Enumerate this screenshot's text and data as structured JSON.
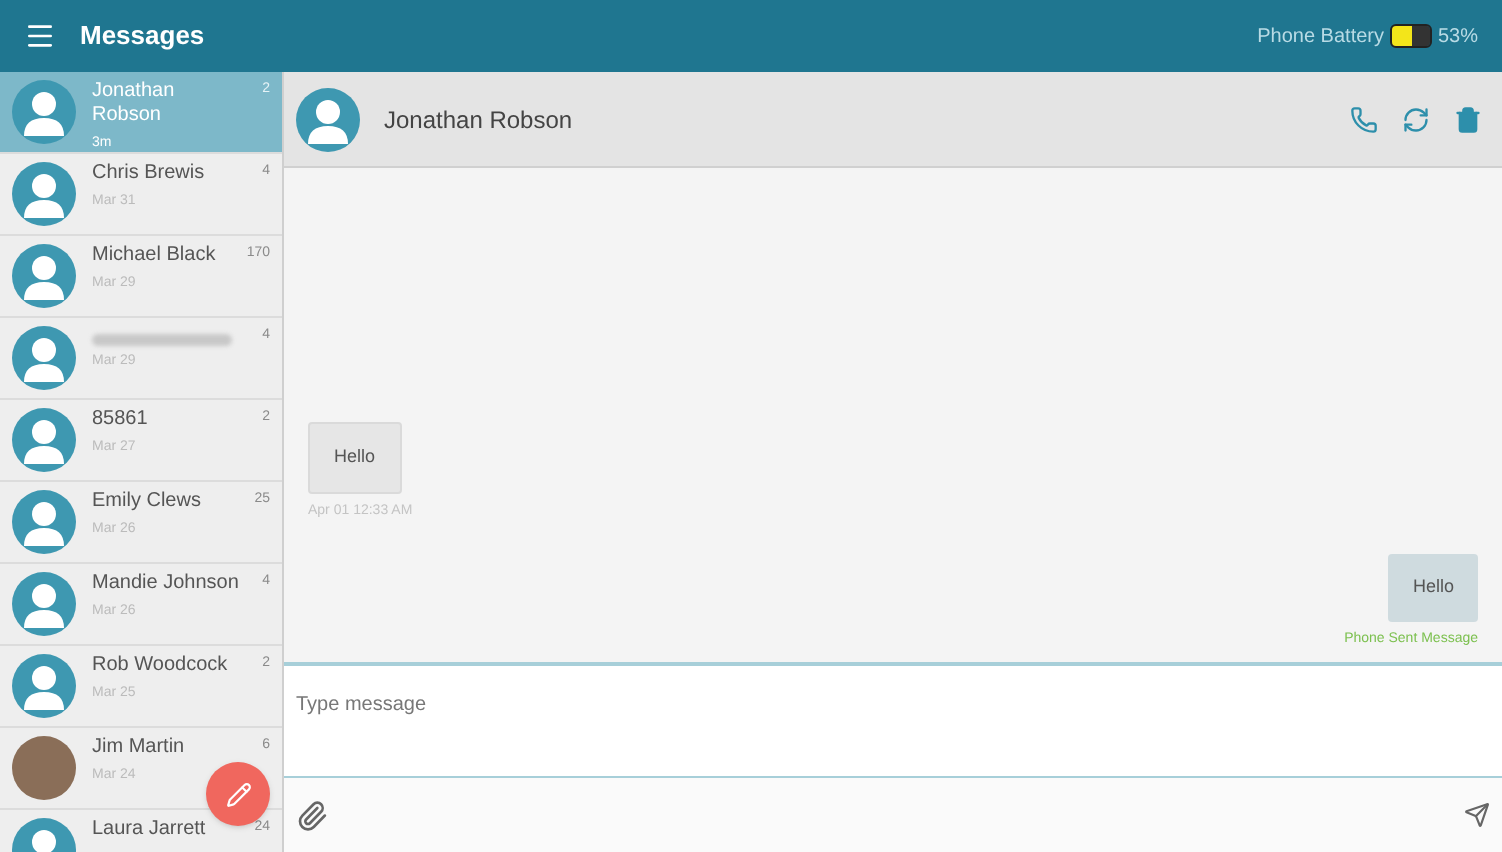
{
  "app_bar": {
    "title": "Messages",
    "battery_label": "Phone Battery",
    "battery": {
      "level": 0.55
    },
    "battery_reading": "53%"
  },
  "conversations": [
    {
      "name": "Jonathan Robson",
      "date": "3m",
      "count": "2",
      "selected": true,
      "kind": "silhouette"
    },
    {
      "name": "Chris Brewis",
      "date": "Mar 31",
      "count": "4",
      "selected": false,
      "kind": "silhouette"
    },
    {
      "name": "Michael Black",
      "date": "Mar 29",
      "count": "170",
      "selected": false,
      "kind": "silhouette"
    },
    {
      "date": "Mar 29",
      "count": "4",
      "selected": false,
      "kind": "silhouette",
      "blurred": true
    },
    {
      "name": "85861",
      "date": "Mar 27",
      "count": "2",
      "selected": false,
      "kind": "silhouette"
    },
    {
      "name": "Emily Clews",
      "date": "Mar 26",
      "count": "25",
      "selected": false,
      "kind": "silhouette"
    },
    {
      "name": "Mandie Johnson",
      "date": "Mar 26",
      "count": "4",
      "selected": false,
      "kind": "silhouette"
    },
    {
      "name": "Rob Woodcock",
      "date": "Mar 25",
      "count": "2",
      "selected": false,
      "kind": "silhouette"
    },
    {
      "name": "Jim Martin",
      "date": "Mar 24",
      "count": "6",
      "selected": false,
      "kind": "photo"
    },
    {
      "name": "Laura Jarrett",
      "count": "24",
      "selected": false,
      "kind": "silhouette"
    }
  ],
  "chat": {
    "contact": "Jonathan Robson",
    "messages": [
      {
        "outgoing": false,
        "text": "Hello",
        "meta": "Apr 01 12:33 AM"
      },
      {
        "outgoing": true,
        "text": "Hello",
        "meta": "Phone Sent Message"
      }
    ],
    "composer": {
      "placeholder": "Type message"
    }
  }
}
